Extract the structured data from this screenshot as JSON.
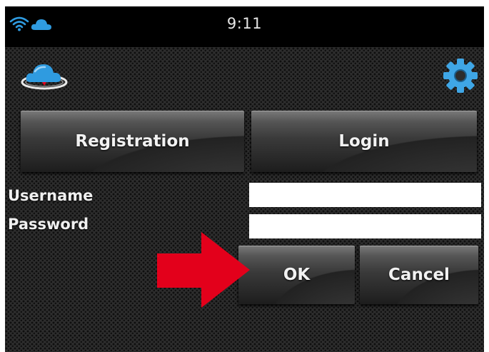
{
  "status_bar": {
    "time": "9:11",
    "icons": [
      "wifi-icon",
      "cloud-icon"
    ]
  },
  "header": {
    "logo_icon": "cloud-logo-icon",
    "settings_icon": "gear-icon"
  },
  "tabs": {
    "registration_label": "Registration",
    "login_label": "Login"
  },
  "form": {
    "username_label": "Username",
    "username_value": "",
    "password_label": "Password",
    "password_value": ""
  },
  "actions": {
    "ok_label": "OK",
    "cancel_label": "Cancel"
  },
  "annotation": {
    "arrow_icon": "red-arrow-icon",
    "arrow_color": "#e3001b"
  },
  "colors": {
    "cloud_blue": "#2f9be0",
    "gear_blue": "#3fa6e6"
  }
}
